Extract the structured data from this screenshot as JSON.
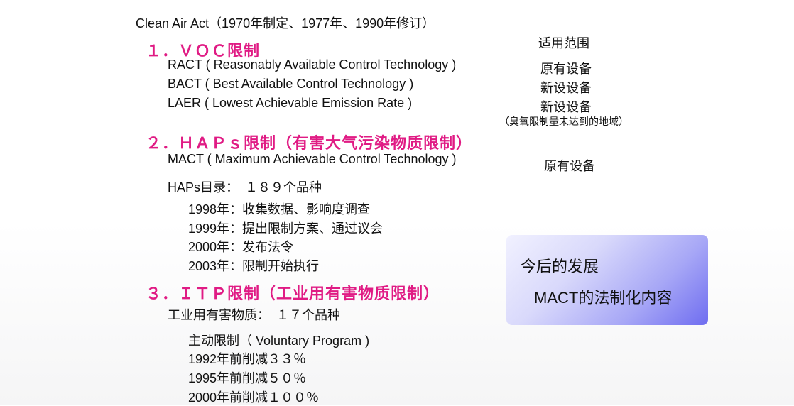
{
  "title": "Clean Air Act（1970年制定、1977年、1990年修订）",
  "scope_header": "适用范围",
  "voc": {
    "heading": "１．ＶＯＣ限制",
    "items": [
      "RACT ( Reasonably Available Control Technology )",
      "BACT ( Best Available Control Technology )",
      "LAER ( Lowest Achievable Emission Rate )"
    ],
    "scopes": [
      "原有设备",
      "新设设备",
      "新设设备"
    ],
    "note": "（臭氧限制量未达到的地域）"
  },
  "haps": {
    "heading": "２．ＨＡＰｓ限制（有害大气污染物质限制）",
    "mact": "MACT ( Maximum Achievable Control Technology )",
    "mact_scope": "原有设备",
    "list_label": "HAPs目录：　１８９个品种",
    "timeline": [
      "1998年：收集数据、影响度调查",
      "1999年：提出限制方案、通过议会",
      "2000年：发布法令",
      "2003年：限制开始执行"
    ]
  },
  "itp": {
    "heading": "３．ＩＴＰ限制（工业用有害物质限制）",
    "substances": "工业用有害物质：　１７个品种",
    "program": "主动限制（ Voluntary Program )",
    "reductions": [
      "1992年前削减３３％",
      "1995年前削减５０％",
      "2000年前削减１００％"
    ]
  },
  "future_box": {
    "title": "今后的发展",
    "body": "MACT的法制化内容"
  }
}
